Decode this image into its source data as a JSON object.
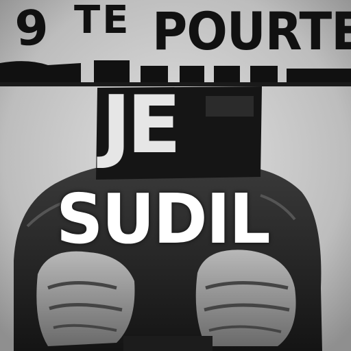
{
  "texts": {
    "top_left": "9",
    "top_middle": "TE",
    "top_right": "POURTE",
    "sign": "JE",
    "bottom": "SUDIL"
  },
  "colors": {
    "background": "#cfcfcf",
    "bar": "#111111",
    "figure": "#2a2a2a",
    "sign_board": "#151515",
    "light_text": "#ffffff"
  }
}
